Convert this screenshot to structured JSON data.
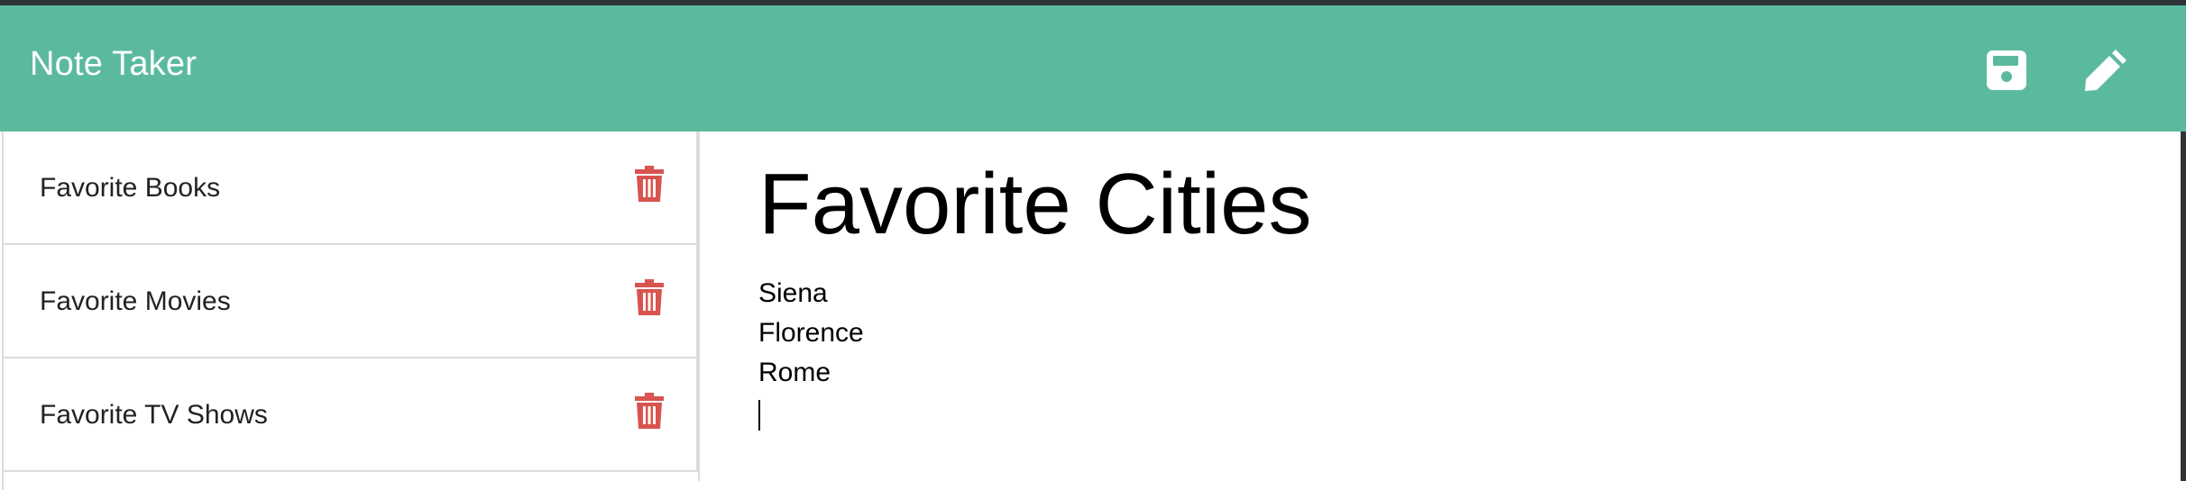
{
  "app": {
    "title": "Note Taker"
  },
  "toolbar": {
    "save_icon": "save-icon",
    "edit_icon": "pencil-icon"
  },
  "colors": {
    "navbar": "#5bba9e",
    "delete": "#d9534f"
  },
  "sidebar": {
    "notes": [
      {
        "label": "Favorite Books",
        "icon": "trash-icon"
      },
      {
        "label": "Favorite Movies",
        "icon": "trash-icon"
      },
      {
        "label": "Favorite TV Shows",
        "icon": "trash-icon"
      }
    ]
  },
  "editor": {
    "title": "Favorite Cities",
    "body_lines": [
      "Siena",
      "Florence",
      "Rome"
    ]
  }
}
